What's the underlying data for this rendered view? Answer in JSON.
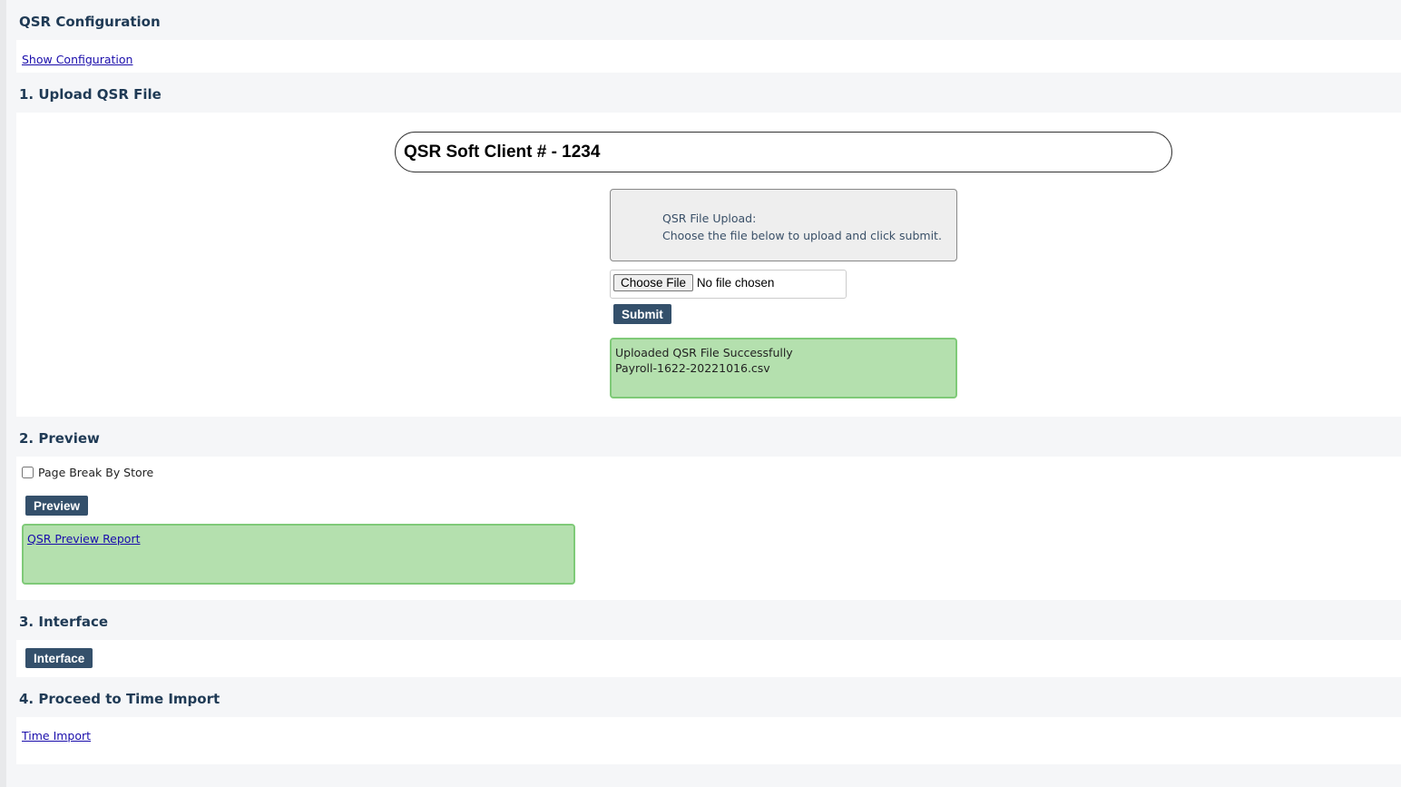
{
  "config": {
    "title": "QSR Configuration",
    "show_link": "Show Configuration"
  },
  "upload": {
    "title": "1. Upload QSR File",
    "client_label": "QSR Soft Client # -  1234",
    "info_line1": "QSR File Upload:",
    "info_line2": "Choose the file below to upload and click submit.",
    "choose_file": "Choose File",
    "no_file": "No file chosen",
    "submit": "Submit",
    "success_line1": "Uploaded QSR File Successfully",
    "success_line2": "Payroll-1622-20221016.csv"
  },
  "preview": {
    "title": "2. Preview",
    "checkbox_label": "Page Break By Store",
    "checked": false,
    "button": "Preview",
    "report_link": "QSR Preview Report"
  },
  "interface": {
    "title": "3. Interface",
    "button": "Interface"
  },
  "time": {
    "title": "4. Proceed to Time Import",
    "link": "Time Import"
  }
}
